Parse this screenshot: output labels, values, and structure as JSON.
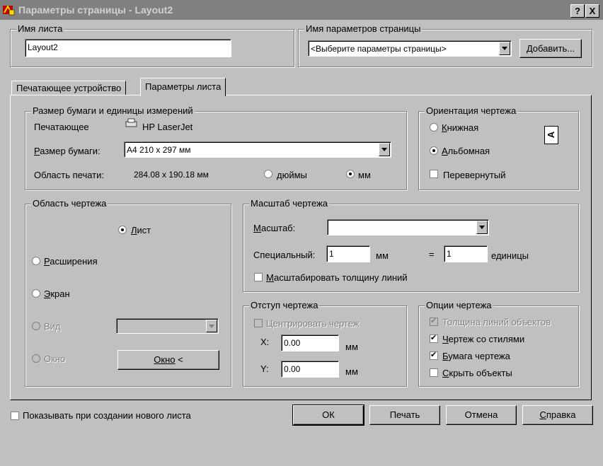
{
  "window": {
    "title": "Параметры страницы - Layout2",
    "help_btn": "?",
    "close_btn": "X"
  },
  "sheet_name": {
    "legend": "Имя листа",
    "value": "Layout2"
  },
  "page_setup_name": {
    "legend": "Имя параметров страницы",
    "selected": "<Выберите параметры страницы>",
    "add_button": "Добавить..."
  },
  "tabs": [
    {
      "label": "Печатающее устройство"
    },
    {
      "label": "Параметры листа"
    }
  ],
  "paper": {
    "legend": "Размер бумаги и единицы измерений",
    "device_label": "Печатающее",
    "device_name": "HP LaserJet",
    "size_label": "Размер бумаги:",
    "size_value": "А4 210 x 297 мм",
    "print_area_label": "Область печати:",
    "print_area_value": "284.08 x 190.18 мм",
    "inches": "дюймы",
    "mm": "мм"
  },
  "orientation": {
    "legend": "Ориентация чертежа",
    "portrait": "Книжная",
    "landscape": "Альбомная",
    "flipped": "Перевернутый",
    "icon_glyph": "A"
  },
  "plot_area": {
    "legend": "Область чертежа",
    "sheet": "Лист",
    "extents": "Расширения",
    "screen": "Экран",
    "view": "Вид",
    "window": "Окно",
    "window_button": "Окно <"
  },
  "scale": {
    "legend": "Масштаб чертежа",
    "scale_label": "Масштаб:",
    "scale_value": "",
    "custom_label": "Специальный:",
    "custom_value": "1",
    "mm": "мм",
    "equals": "=",
    "units_value": "1",
    "units_label": "единицы",
    "scale_lineweights": "Масштабировать толщину линий"
  },
  "offset": {
    "legend": "Отступ чертежа",
    "center": "Центрировать чертеж",
    "x_label": "X:",
    "x_value": "0.00",
    "x_unit": "мм",
    "y_label": "Y:",
    "y_value": "0.00",
    "y_unit": "мм"
  },
  "options": {
    "legend": "Опции чертежа",
    "lineweights": "Толщина линий объектов",
    "plot_styles": "Чертеж со стилями",
    "paperspace_last": "Бумага чертежа",
    "hide_objects": "Скрыть объекты"
  },
  "footer": {
    "show_on_new": "Показывать при создании нового листа",
    "ok": "ОК",
    "print": "Печать",
    "cancel": "Отмена",
    "help": "Справка"
  }
}
